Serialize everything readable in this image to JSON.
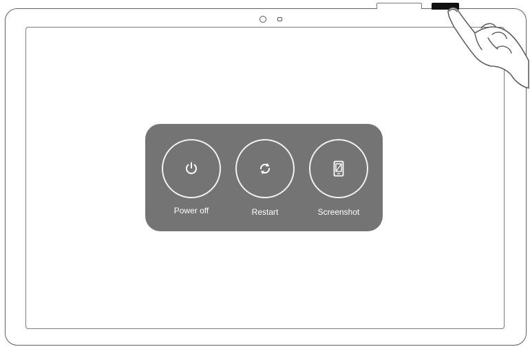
{
  "power_menu": {
    "options": [
      {
        "label": "Power off",
        "icon": "power-icon"
      },
      {
        "label": "Restart",
        "icon": "restart-icon"
      },
      {
        "label": "Screenshot",
        "icon": "screenshot-icon"
      }
    ]
  },
  "device": {
    "hardware_keys": [
      "volume-key",
      "power-key"
    ],
    "front_sensors": [
      "front-camera",
      "light-sensor"
    ]
  },
  "colors": {
    "menu_background": "#747474",
    "menu_foreground": "#ffffff",
    "device_outline": "#5f5f5f",
    "power_key": "#111111"
  }
}
